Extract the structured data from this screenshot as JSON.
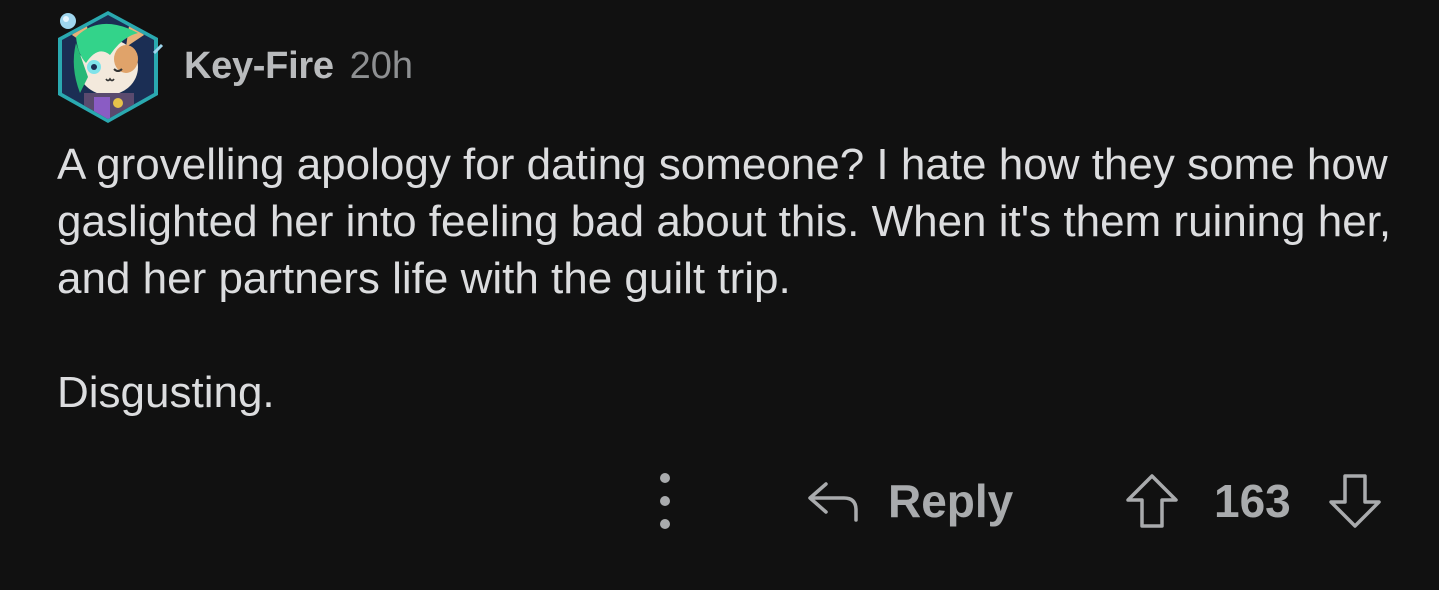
{
  "comment": {
    "username": "Key-Fire",
    "timestamp": "20h",
    "body": [
      "A grovelling apology for dating someone? I hate how they some how gaslighted her into feeling bad about this. When it's them ruining her, and her partners life with the guilt trip.",
      "Disgusting."
    ]
  },
  "actions": {
    "reply_label": "Reply",
    "score": "163"
  },
  "icons": {
    "more": "more-vertical-icon",
    "reply": "reply-arrow-icon",
    "upvote": "upvote-arrow-icon",
    "downvote": "downvote-arrow-icon"
  },
  "colors": {
    "background": "#111111",
    "text": "#dcdddf",
    "muted": "#a9abad",
    "avatar_ring": "#37c4c8"
  }
}
